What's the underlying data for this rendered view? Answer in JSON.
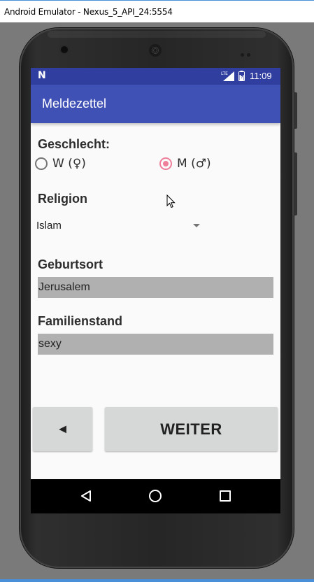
{
  "window": {
    "title": "Android Emulator - Nexus_5_API_24:5554"
  },
  "status_bar": {
    "time": "11:09",
    "network": "LTE"
  },
  "app_bar": {
    "title": "Meldezettel"
  },
  "form": {
    "gender": {
      "label": "Geschlecht:",
      "options": [
        {
          "label": "W (♀)",
          "selected": false
        },
        {
          "label": "M (♂)",
          "selected": true
        }
      ]
    },
    "religion": {
      "label": "Religion",
      "selected": "Islam"
    },
    "birthplace": {
      "label": "Geburtsort",
      "value": "Jerusalem"
    },
    "marital_status": {
      "label": "Familienstand",
      "value": "sexy"
    }
  },
  "buttons": {
    "back_label": "◄",
    "next_label": "WEITER"
  },
  "colors": {
    "primary": "#3f51b5",
    "primary_dark": "#303f9f",
    "accent": "#ef7f9b",
    "field_bg": "#b0b0b0",
    "button_bg": "#d6d7d7"
  },
  "icons": [
    "android-n-icon",
    "lte-signal-icon",
    "battery-icon",
    "nav-back-icon",
    "nav-home-icon",
    "nav-recents-icon",
    "mouse-cursor-icon"
  ]
}
